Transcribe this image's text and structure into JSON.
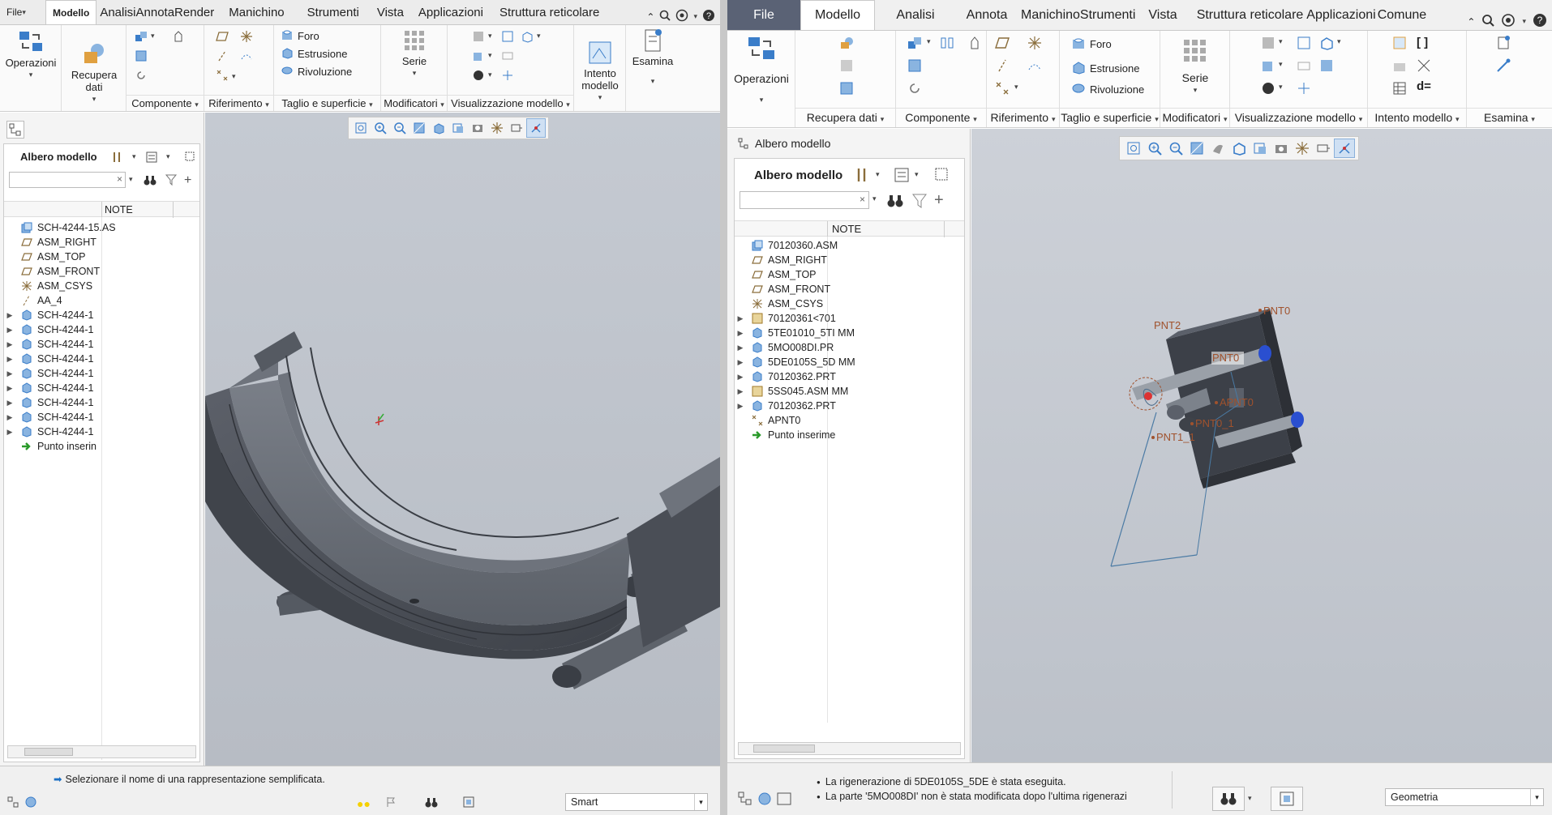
{
  "left": {
    "tabs": [
      "File",
      "Modello",
      "AnalisiAnnotaRender",
      "Manichino",
      "Strumenti",
      "Vista",
      "Applicazioni",
      "Struttura reticolare"
    ],
    "ribbon": {
      "operazioni": "Operazioni",
      "recupera": "Recupera\ndati",
      "foro": "Foro",
      "estrusione": "Estrusione",
      "rivoluzione": "Rivoluzione",
      "serie": "Serie",
      "intento": "Intento\nmodello",
      "esamina": "Esamina",
      "groups": [
        "Componente",
        "Riferimento",
        "Taglio e superficie",
        "Modificatori",
        "Visualizzazione modello"
      ]
    },
    "tree": {
      "title": "Albero modello",
      "column": "NOTE",
      "items": [
        "SCH-4244-15.AS",
        "ASM_RIGHT",
        "ASM_TOP",
        "ASM_FRONT",
        "ASM_CSYS",
        "AA_4",
        "SCH-4244-1",
        "SCH-4244-1",
        "SCH-4244-1",
        "SCH-4244-1",
        "SCH-4244-1",
        "SCH-4244-1",
        "SCH-4244-1",
        "SCH-4244-1",
        "SCH-4244-1",
        "Punto inserin"
      ]
    },
    "status": {
      "message": "Selezionare il nome di una rappresentazione semplificata.",
      "filter": "Smart"
    }
  },
  "right": {
    "tabs": [
      "File",
      "Modello",
      "Analisi",
      "Annota",
      "ManichinoStrumenti",
      "Vista",
      "Struttura reticolare",
      "Applicazioni",
      "Comune"
    ],
    "ribbon": {
      "operazioni": "Operazioni",
      "foro": "Foro",
      "estrusione": "Estrusione",
      "rivoluzione": "Rivoluzione",
      "serie": "Serie",
      "groups": [
        "Recupera dati",
        "Componente",
        "Riferimento",
        "Taglio e superficie",
        "Modificatori",
        "Visualizzazione modello",
        "Intento modello",
        "Esamina"
      ]
    },
    "tree": {
      "tab": "Albero modello",
      "title": "Albero modello",
      "column": "NOTE",
      "items": [
        "70120360.ASM",
        "ASM_RIGHT",
        "ASM_TOP",
        "ASM_FRONT",
        "ASM_CSYS",
        "70120361<701",
        "5TE01010_5TI MM",
        "5MO008DI.PR",
        "5DE0105S_5D MM",
        "70120362.PRT",
        "5SS045.ASM  MM",
        "70120362.PRT",
        "APNT0",
        "Punto inserime"
      ]
    },
    "labels": [
      "PNT0",
      "PNT2",
      "PNT0",
      "APNT0",
      "PNT0_1",
      "PNT1_1"
    ],
    "status": {
      "msg1": "La rigenerazione di 5DE0105S_5DE è stata eseguita.",
      "msg2": "La parte '5MO008DI' non è stata modificata dopo l'ultima rigenerazi",
      "filter": "Geometria"
    }
  },
  "colors": {
    "fileTab": "#5a6275",
    "viewport": "#bcc1c9",
    "accent": "#1a6fc4",
    "pointLabel": "#a0522d"
  }
}
